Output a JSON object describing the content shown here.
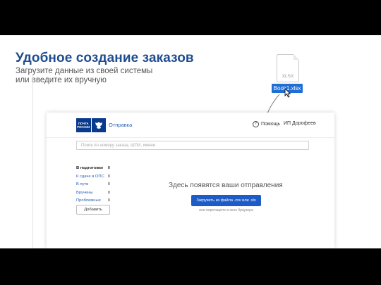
{
  "slide": {
    "headline": "Удобное создание заказов",
    "subtitle_line1": "Загрузите данные из своей системы",
    "subtitle_line2": "или введите их вручную"
  },
  "file": {
    "extension": "XLSX",
    "name": "Book1.xlsx"
  },
  "app": {
    "logo_line1": "ПОЧТА",
    "logo_line2": "РОССИИ",
    "nav_link": "Отправка",
    "help_label": "Помощь",
    "help_icon_glyph": "?",
    "user_name": "ИП Дорофеев",
    "search_placeholder": "Поиск по номеру заказа, ШПИ, имени",
    "sidebar": [
      {
        "label": "В подготовке",
        "count": "0"
      },
      {
        "label": "К сдаче в ОПС",
        "count": "0"
      },
      {
        "label": "В пути",
        "count": "0"
      },
      {
        "label": "Вручены",
        "count": "0"
      },
      {
        "label": "Проблемные",
        "count": "0"
      }
    ],
    "add_button": "Добавить",
    "empty_text": "Здесь появятся ваши отправления",
    "upload_button": "Загрузить из файла .csv или .xls",
    "drag_hint": "или перетащите в окно браузера"
  },
  "colors": {
    "headline": "#1f4d8f",
    "accent_blue": "#1d5cc6",
    "brand_blue": "#0a3a8c"
  },
  "icons": {
    "file": "xlsx-file-icon",
    "cursor": "mouse-pointer-icon",
    "emblem": "eagle-emblem-icon",
    "help": "question-circle-icon"
  }
}
